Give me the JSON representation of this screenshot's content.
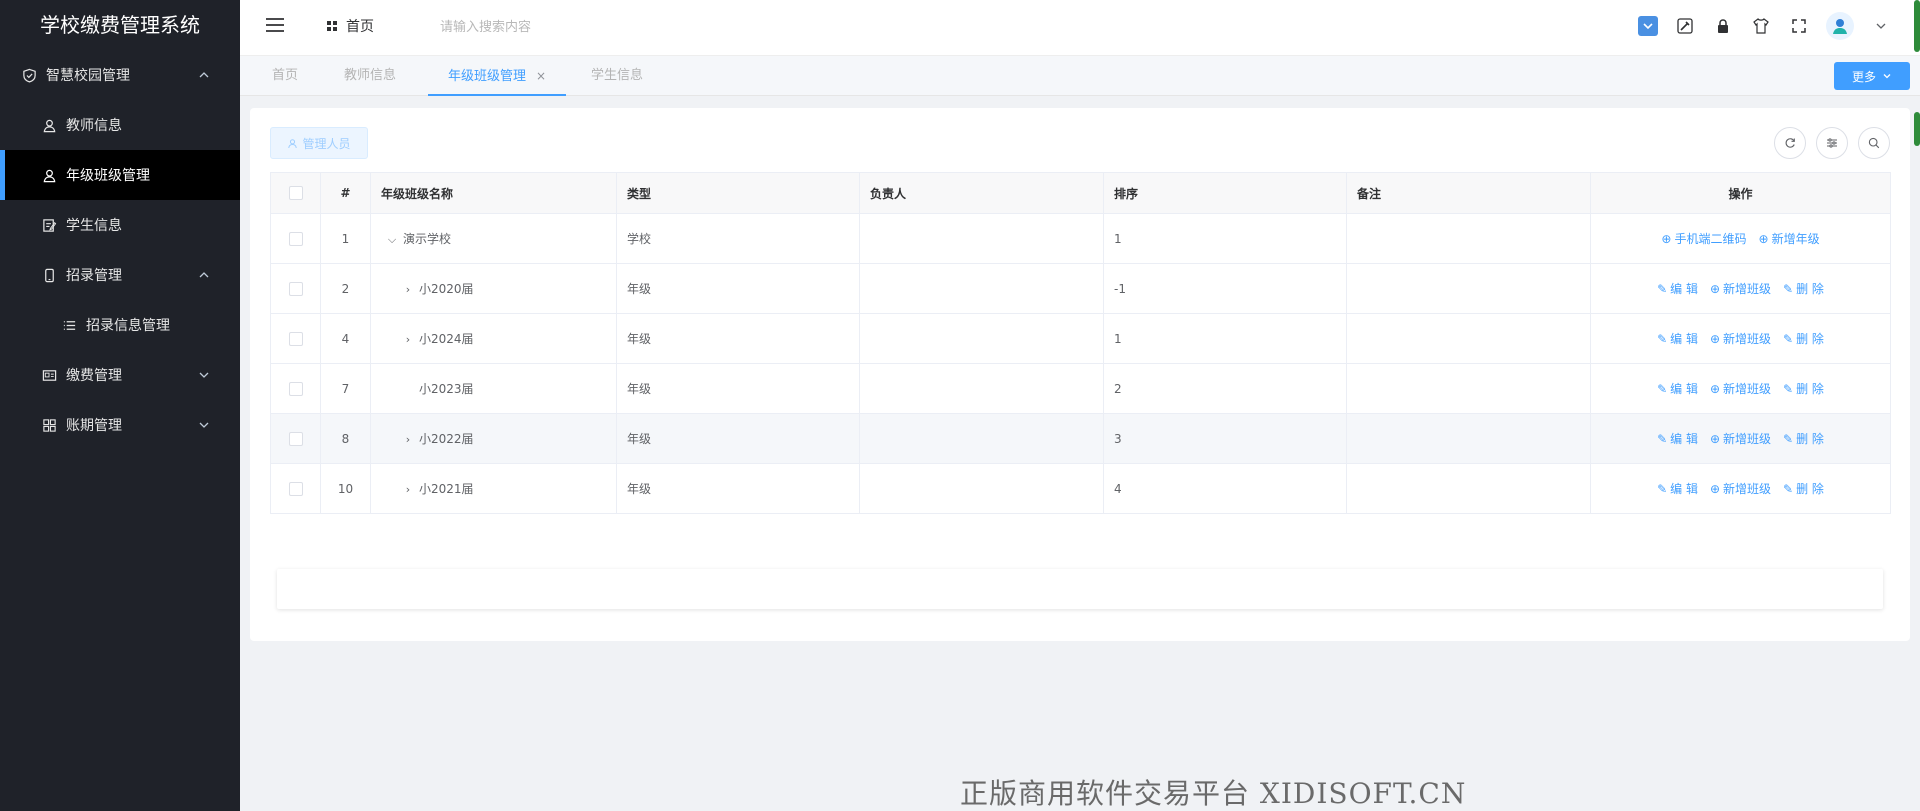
{
  "app": {
    "title": "学校缴费管理系统"
  },
  "sidebar": {
    "groups": [
      {
        "label": "智慧校园管理"
      },
      {
        "label": "招录管理"
      },
      {
        "label": "缴费管理"
      },
      {
        "label": "账期管理"
      }
    ],
    "items": [
      {
        "label": "教师信息"
      },
      {
        "label": "年级班级管理"
      },
      {
        "label": "学生信息"
      },
      {
        "label": "招录信息管理"
      }
    ]
  },
  "header": {
    "home": "首页",
    "search_placeholder": "请输入搜索内容"
  },
  "tabs": [
    {
      "label": "首页"
    },
    {
      "label": "教师信息"
    },
    {
      "label": "年级班级管理",
      "close": "×"
    },
    {
      "label": "学生信息"
    }
  ],
  "more_button": "更多",
  "toolbar": {
    "admin_button": "管理人员"
  },
  "table": {
    "columns": [
      "#",
      "年级班级名称",
      "类型",
      "负责人",
      "排序",
      "备注",
      "操作"
    ],
    "rows": [
      {
        "id": "1",
        "name": "演示学校",
        "type": "学校",
        "owner": "",
        "sort": "1",
        "note": "",
        "expand": "⌵",
        "ops": [
          "手机端二维码",
          "新增年级"
        ]
      },
      {
        "id": "2",
        "name": "小2020届",
        "type": "年级",
        "owner": "",
        "sort": "-1",
        "note": "",
        "expand": "›",
        "ops": [
          "编 辑",
          "新增班级",
          "删 除"
        ]
      },
      {
        "id": "4",
        "name": "小2024届",
        "type": "年级",
        "owner": "",
        "sort": "1",
        "note": "",
        "expand": "›",
        "ops": [
          "编 辑",
          "新增班级",
          "删 除"
        ]
      },
      {
        "id": "7",
        "name": "小2023届",
        "type": "年级",
        "owner": "",
        "sort": "2",
        "note": "",
        "expand": "",
        "ops": [
          "编 辑",
          "新增班级",
          "删 除"
        ]
      },
      {
        "id": "8",
        "name": "小2022届",
        "type": "年级",
        "owner": "",
        "sort": "3",
        "note": "",
        "expand": "›",
        "ops": [
          "编 辑",
          "新增班级",
          "删 除"
        ]
      },
      {
        "id": "10",
        "name": "小2021届",
        "type": "年级",
        "owner": "",
        "sort": "4",
        "note": "",
        "expand": "›",
        "ops": [
          "编 辑",
          "新增班级",
          "删 除"
        ]
      }
    ]
  },
  "watermark": "正版商用软件交易平台 XIDISOFT.CN",
  "colors": {
    "primary": "#409eff",
    "sidebar_bg": "#1f2229",
    "active_item_bg": "#000000"
  }
}
